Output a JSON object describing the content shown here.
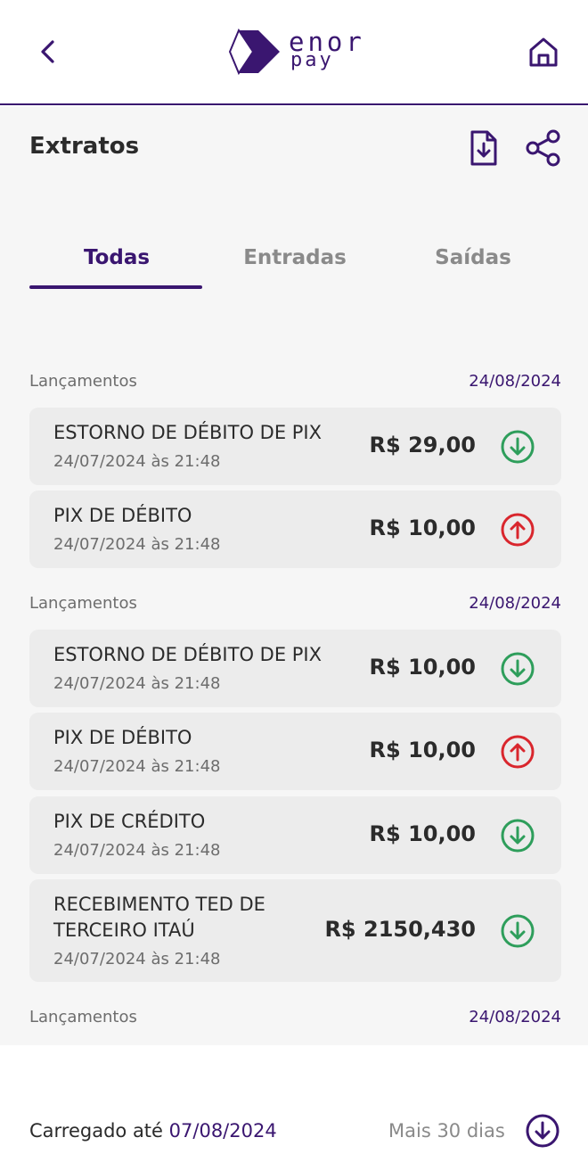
{
  "header": {
    "brand_top": "enor",
    "brand_bottom": "pay",
    "back_icon": "chevron-left-icon",
    "home_icon": "home-icon"
  },
  "page": {
    "title": "Extratos",
    "download_icon": "file-download-icon",
    "share_icon": "share-icon"
  },
  "tabs": [
    {
      "label": "Todas",
      "active": true
    },
    {
      "label": "Entradas",
      "active": false
    },
    {
      "label": "Saídas",
      "active": false
    }
  ],
  "sections": [
    {
      "label": "Lançamentos",
      "date": "24/08/2024",
      "items": [
        {
          "title": "ESTORNO DE DÉBITO DE PIX",
          "date": "24/07/2024 às 21:48",
          "amount": "R$ 29,00",
          "direction": "in"
        },
        {
          "title": "PIX DE DÉBITO",
          "date": "24/07/2024 às 21:48",
          "amount": "R$ 10,00",
          "direction": "out"
        }
      ]
    },
    {
      "label": "Lançamentos",
      "date": "24/08/2024",
      "items": [
        {
          "title": "ESTORNO DE DÉBITO DE PIX",
          "date": "24/07/2024 às 21:48",
          "amount": "R$ 10,00",
          "direction": "in"
        },
        {
          "title": "PIX DE DÉBITO",
          "date": "24/07/2024 às 21:48",
          "amount": "R$ 10,00",
          "direction": "out"
        },
        {
          "title": "PIX DE CRÉDITO",
          "date": "24/07/2024 às 21:48",
          "amount": "R$ 10,00",
          "direction": "in"
        },
        {
          "title_lines": [
            "RECEBIMENTO TED DE",
            "TERCEIRO ITAÚ"
          ],
          "date": "24/07/2024 às 21:48",
          "amount": "R$ 2150,430",
          "direction": "in"
        }
      ]
    },
    {
      "label": "Lançamentos",
      "date": "24/08/2024",
      "items": []
    }
  ],
  "footer": {
    "loaded_prefix": "Carregado até",
    "loaded_date": "07/08/2024",
    "more_label": "Mais 30 dias",
    "more_icon": "circle-arrow-down-icon"
  },
  "colors": {
    "brand": "#3a1670",
    "income": "#2e9e5b",
    "expense": "#d9262d",
    "card_bg": "#ececec",
    "page_bg": "#f6f6f6"
  }
}
